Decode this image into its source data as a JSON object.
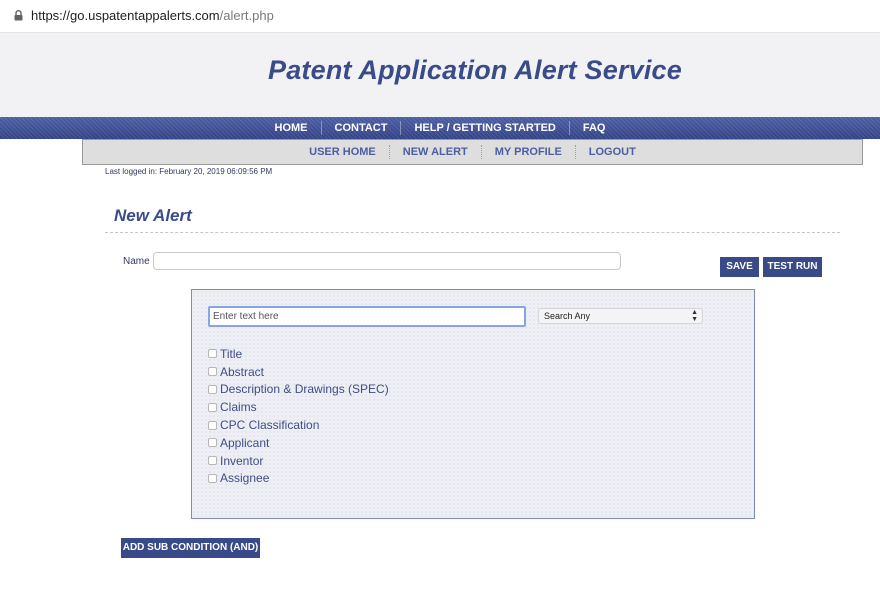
{
  "browser": {
    "url_host": "https://go.uspatentappalerts.com",
    "url_path": "/alert.php"
  },
  "header": {
    "title": "Patent Application Alert Service"
  },
  "top_nav": [
    "HOME",
    "CONTACT",
    "HELP / GETTING STARTED",
    "FAQ"
  ],
  "sub_nav": [
    "USER HOME",
    "NEW ALERT",
    "MY PROFILE",
    "LOGOUT"
  ],
  "last_logged": "Last logged in: February 20, 2019 06:09:56 PM",
  "page": {
    "heading": "New Alert",
    "name_label": "Name",
    "name_value": "",
    "save_label": "SAVE",
    "test_run_label": "TEST RUN",
    "add_sub_condition_label": "ADD SUB CONDITION (AND)"
  },
  "condition": {
    "input_placeholder": "Enter text here",
    "select_value": "Search Any",
    "fields": [
      {
        "label": "Title",
        "checked": false
      },
      {
        "label": "Abstract",
        "checked": false
      },
      {
        "label": "Description & Drawings (SPEC)",
        "checked": false
      },
      {
        "label": "Claims",
        "checked": false
      },
      {
        "label": "CPC Classification",
        "checked": false
      },
      {
        "label": "Applicant",
        "checked": false
      },
      {
        "label": "Inventor",
        "checked": false
      },
      {
        "label": "Assignee",
        "checked": false
      }
    ]
  },
  "colors": {
    "brand_blue": "#384a88",
    "title_blue": "#3a4b8a",
    "link_blue": "#4a5ea3"
  },
  "icons": {
    "lock": "lock-icon",
    "select_arrows": "select-arrows-icon"
  }
}
